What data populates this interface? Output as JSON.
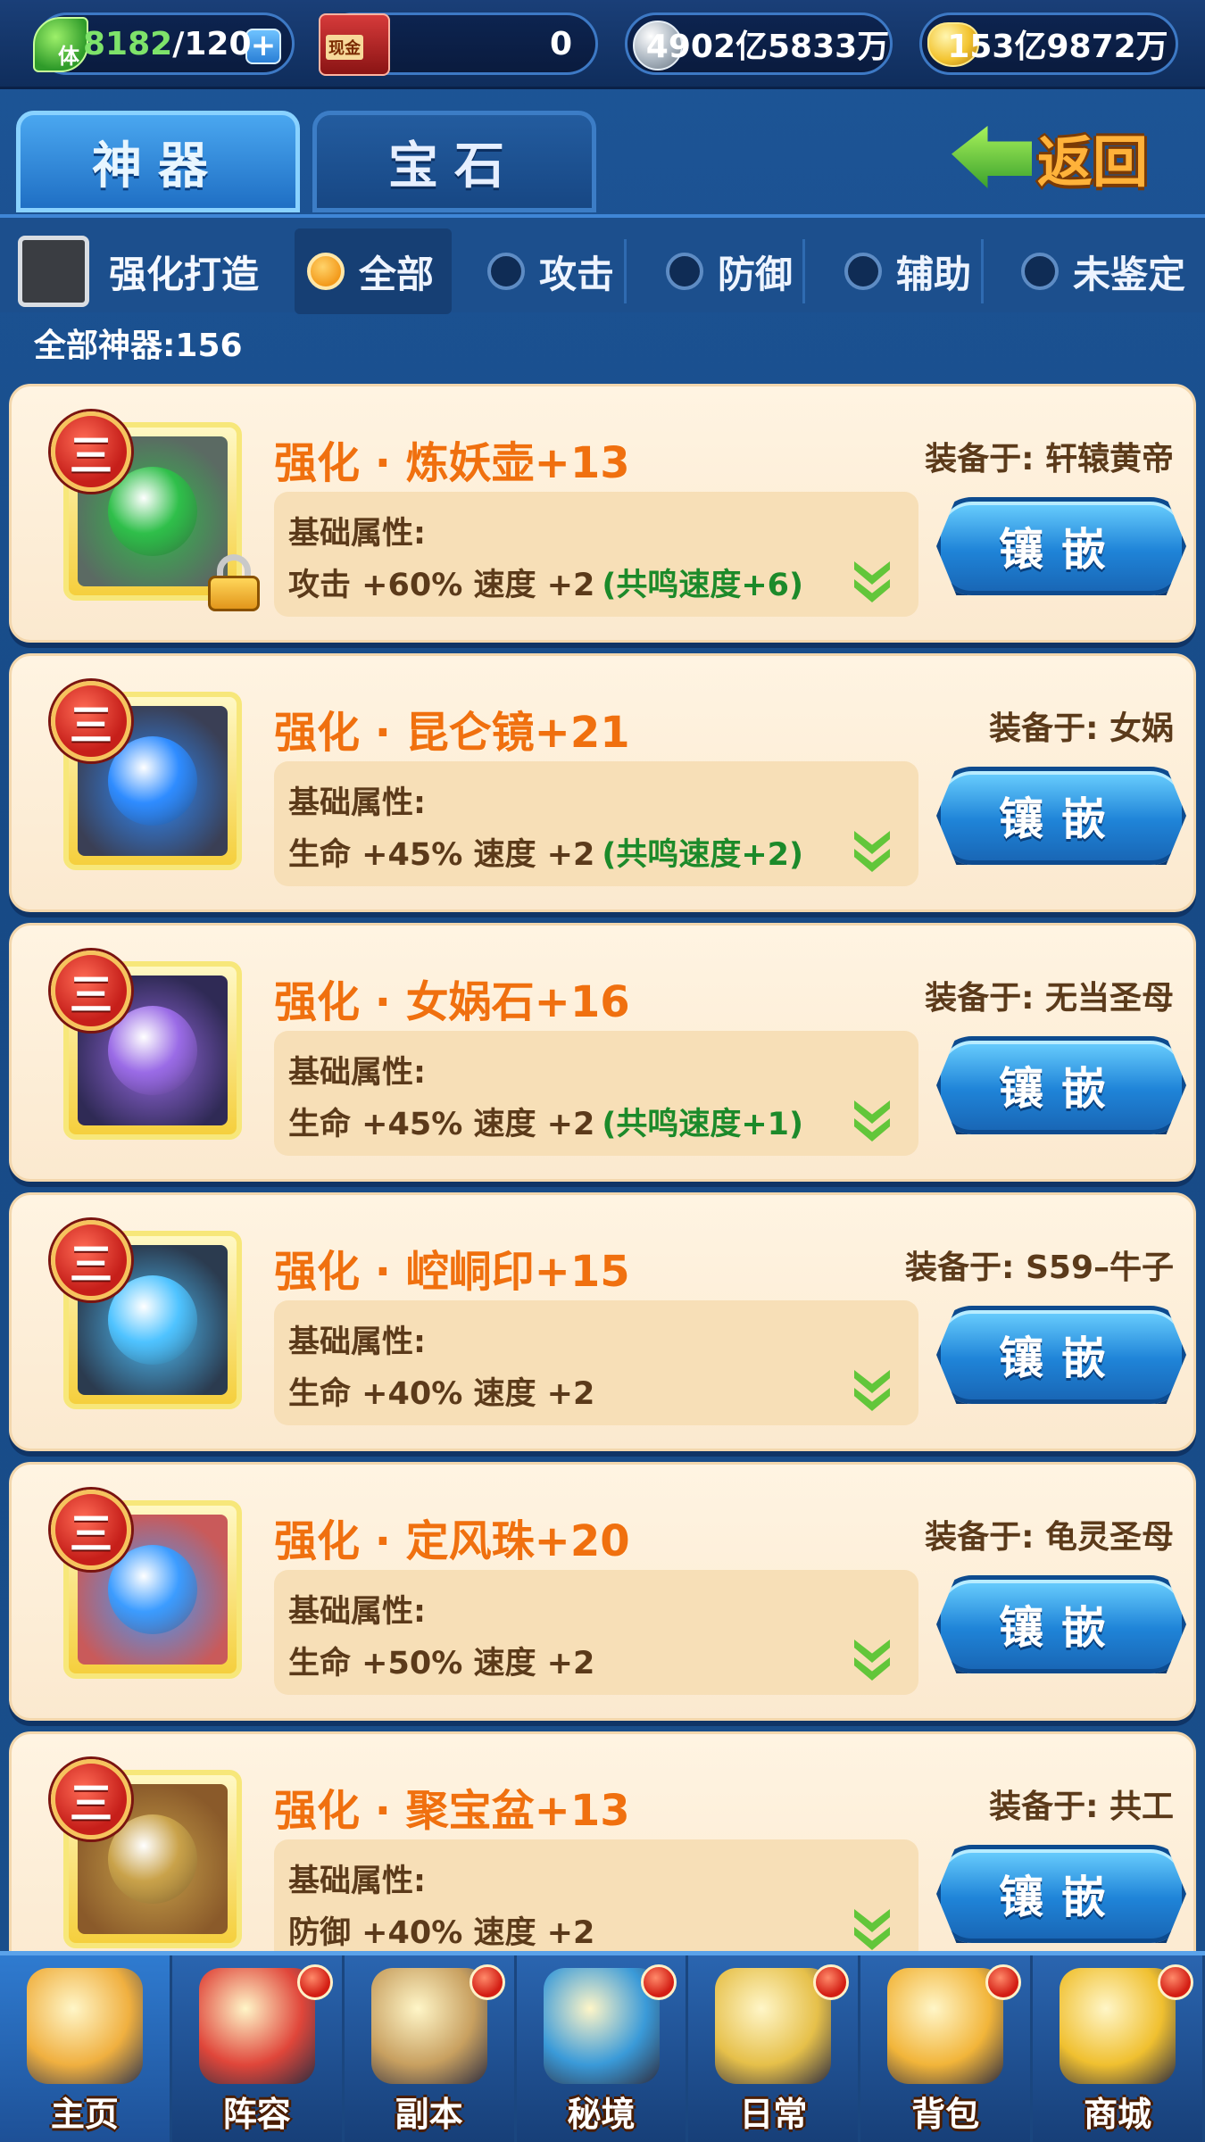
{
  "topbar": {
    "stamina": {
      "icon": "leaf-icon",
      "icon_text": "体",
      "current": "8182",
      "max": "/120",
      "plus": "+"
    },
    "cash": {
      "icon": "cash-icon",
      "icon_text": "现金",
      "value": "0"
    },
    "silver": {
      "icon": "silver-coin-icon",
      "value": "4902亿5833万"
    },
    "gold": {
      "icon": "gold-ingot-icon",
      "value": "153亿9872万"
    }
  },
  "tabs": [
    {
      "label": "神器",
      "active": true
    },
    {
      "label": "宝石",
      "active": false
    }
  ],
  "back": {
    "label": "返回",
    "icon": "back-arrow-icon"
  },
  "filter": {
    "checkbox_label": "强化打造",
    "options": [
      {
        "label": "全部",
        "selected": true
      },
      {
        "label": "攻击",
        "selected": false
      },
      {
        "label": "防御",
        "selected": false
      },
      {
        "label": "辅助",
        "selected": false
      },
      {
        "label": "未鉴定",
        "selected": false
      }
    ]
  },
  "count_label": "全部神器:156",
  "items": [
    {
      "tier": "三",
      "name": "强化 · 炼妖壶+13",
      "equipped": "装备于: 轩辕黄帝",
      "attr_title": "基础属性:",
      "attr": "攻击 +60%  速度 +2",
      "resonance": "(共鸣速度+6)",
      "button": "镶嵌",
      "locked": true,
      "accent": "#2fbf4a",
      "frame": "#5b6a63"
    },
    {
      "tier": "三",
      "name": "强化 · 昆仑镜+21",
      "equipped": "装备于: 女娲",
      "attr_title": "基础属性:",
      "attr": "生命 +45%  速度 +2",
      "resonance": "(共鸣速度+2)",
      "button": "镶嵌",
      "locked": false,
      "accent": "#2f8cff",
      "frame": "#3a3f55"
    },
    {
      "tier": "三",
      "name": "强化 · 女娲石+16",
      "equipped": "装备于: 无当圣母",
      "attr_title": "基础属性:",
      "attr": "生命 +45%  速度 +2",
      "resonance": "(共鸣速度+1)",
      "button": "镶嵌",
      "locked": false,
      "accent": "#9a6be6",
      "frame": "#2f2a55"
    },
    {
      "tier": "三",
      "name": "强化 · 崆峒印+15",
      "equipped": "装备于: S59–牛子",
      "attr_title": "基础属性:",
      "attr": "生命 +40%  速度 +2",
      "resonance": "",
      "button": "镶嵌",
      "locked": false,
      "accent": "#4fc3ff",
      "frame": "#2b3b4f"
    },
    {
      "tier": "三",
      "name": "强化 · 定风珠+20",
      "equipped": "装备于: 龟灵圣母",
      "attr_title": "基础属性:",
      "attr": "生命 +50%  速度 +2",
      "resonance": "",
      "button": "镶嵌",
      "locked": false,
      "accent": "#3c9cff",
      "frame": "#c95a5a"
    },
    {
      "tier": "三",
      "name": "强化 · 聚宝盆+13",
      "equipped": "装备于: 共工",
      "attr_title": "基础属性:",
      "attr": "防御 +40%  速度 +2",
      "resonance": "",
      "button": "镶嵌",
      "locked": false,
      "accent": "#c9a24a",
      "frame": "#8a5a2a"
    }
  ],
  "nav": [
    {
      "label": "主页",
      "icon": "palace-icon",
      "active": true,
      "badge": false,
      "color": "#f0b040"
    },
    {
      "label": "阵容",
      "icon": "scroll-icon",
      "active": false,
      "badge": true,
      "color": "#e0463a"
    },
    {
      "label": "副本",
      "icon": "swords-icon",
      "active": false,
      "badge": true,
      "color": "#c8a060"
    },
    {
      "label": "秘境",
      "icon": "portal-icon",
      "active": false,
      "badge": true,
      "color": "#3a9ad8"
    },
    {
      "label": "日常",
      "icon": "scroll-gold-icon",
      "active": false,
      "badge": true,
      "color": "#e6c04a"
    },
    {
      "label": "背包",
      "icon": "bag-icon",
      "active": false,
      "badge": true,
      "color": "#f2b53a"
    },
    {
      "label": "商城",
      "icon": "coins-icon",
      "active": false,
      "badge": true,
      "color": "#f0c030"
    }
  ]
}
